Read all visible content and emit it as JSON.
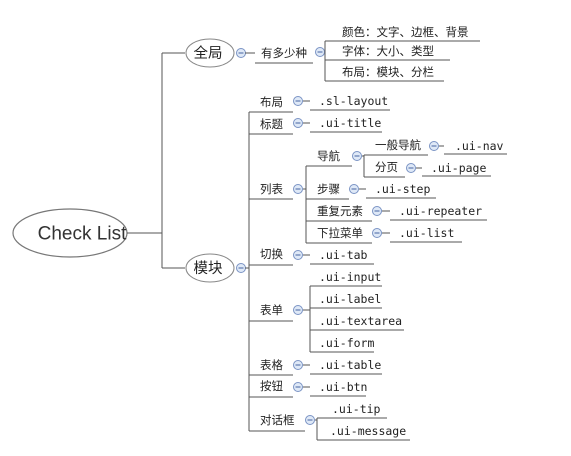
{
  "root": {
    "label": "Check List"
  },
  "branches": {
    "global": {
      "label": "全局",
      "sub": {
        "label": "有多少种",
        "items": [
          "颜色：文字、边框、背景",
          "字体：大小、类型",
          "布局：模块、分栏"
        ]
      }
    },
    "module": {
      "label": "模块",
      "items": {
        "layout": {
          "label": "布局",
          "code": ".sl-layout"
        },
        "title": {
          "label": "标题",
          "code": ".ui-title"
        },
        "list": {
          "label": "列表",
          "nav": {
            "label": "导航",
            "general": {
              "label": "一般导航",
              "code": ".ui-nav"
            },
            "page": {
              "label": "分页",
              "code": ".ui-page"
            }
          },
          "step": {
            "label": "步骤",
            "code": ".ui-step"
          },
          "repeater": {
            "label": "重复元素",
            "code": ".ui-repeater"
          },
          "dropdown": {
            "label": "下拉菜单",
            "code": ".ui-list"
          }
        },
        "tab": {
          "label": "切换",
          "code": ".ui-tab"
        },
        "form": {
          "label": "表单",
          "codes": [
            ".ui-input",
            ".ui-label",
            ".ui-textarea",
            ".ui-form"
          ]
        },
        "table": {
          "label": "表格",
          "code": ".ui-table"
        },
        "button": {
          "label": "按钮",
          "code": ".ui-btn"
        },
        "dialog": {
          "label": "对话框",
          "codes": [
            ".ui-tip",
            ".ui-message"
          ]
        }
      }
    }
  }
}
